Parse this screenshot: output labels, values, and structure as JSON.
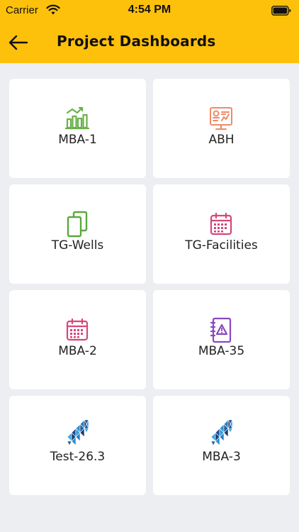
{
  "status_bar": {
    "carrier": "Carrier",
    "time": "4:54 PM",
    "icons": [
      "wifi-icon",
      "battery-icon"
    ]
  },
  "header": {
    "title": "Project Dashboards",
    "back_icon": "back-arrow-icon"
  },
  "colors": {
    "header_bg": "#fec10b",
    "page_bg": "#eceef1",
    "card_bg": "#ffffff"
  },
  "cards": [
    {
      "label": "MBA-1",
      "icon": "bar-chart-growth-icon",
      "color": "#69b04a"
    },
    {
      "label": "ABH",
      "icon": "dashboard-monitor-icon",
      "color": "#f08a68"
    },
    {
      "label": "TG-Wells",
      "icon": "documents-copy-icon",
      "color": "#5aa83e"
    },
    {
      "label": "TG-Facilities",
      "icon": "calendar-icon",
      "color": "#d6477a"
    },
    {
      "label": "MBA-2",
      "icon": "calendar-icon",
      "color": "#d6477a"
    },
    {
      "label": "MBA-35",
      "icon": "notebook-warning-icon",
      "color": "#8a48c0"
    },
    {
      "label": "Test-26.3",
      "icon": "triangle-logo-icon",
      "color": "#2a7fc4"
    },
    {
      "label": "MBA-3",
      "icon": "triangle-logo-icon",
      "color": "#2a7fc4"
    }
  ]
}
